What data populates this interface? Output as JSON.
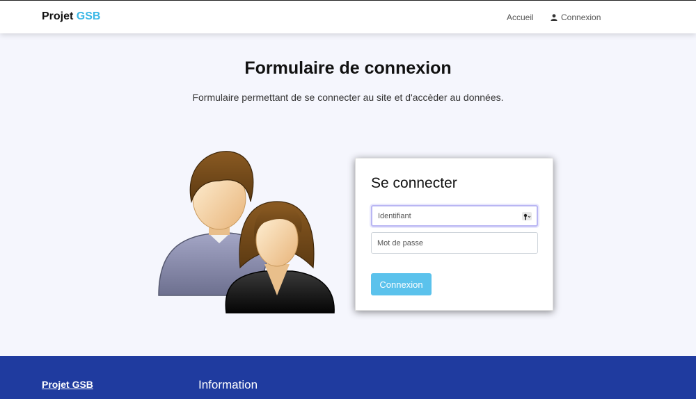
{
  "header": {
    "brand_prefix": "Projet",
    "brand_accent": "GSB",
    "nav": {
      "home": "Accueil",
      "login": "Connexion"
    }
  },
  "main": {
    "title": "Formulaire de connexion",
    "subtitle": "Formulaire permettant de se connecter au site et d'accèder au données.",
    "illustration_icon": "users-icon"
  },
  "login_card": {
    "heading": "Se connecter",
    "username_placeholder": "Identifiant",
    "password_placeholder": "Mot de passe",
    "submit_label": "Connexion",
    "password_manager_icon": "key-icon"
  },
  "footer": {
    "brand": "Projet GSB",
    "info_heading": "Information"
  },
  "colors": {
    "accent": "#3bb8e6",
    "button": "#5bc2ec",
    "footer_bg": "#1f3b9f",
    "page_bg": "#f5f6fd"
  }
}
